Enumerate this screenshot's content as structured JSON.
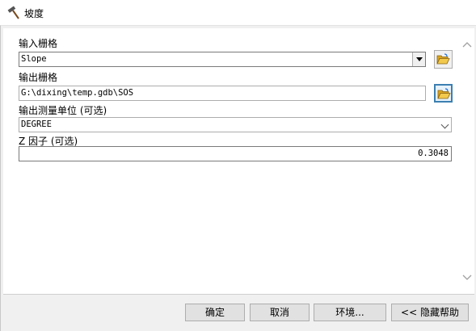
{
  "window": {
    "title": "坡度",
    "icon": "hammer-icon"
  },
  "params": {
    "input_raster": {
      "label": "输入栅格",
      "value": "Slope"
    },
    "output_raster": {
      "label": "输出栅格",
      "value": "G:\\dixing\\temp.gdb\\SOS"
    },
    "measurement": {
      "label": "输出测量单位 (可选)",
      "value": "DEGREE"
    },
    "zfactor": {
      "label": "Z 因子 (可选)",
      "value": "0.3048"
    }
  },
  "buttons": {
    "ok": "确定",
    "cancel": "取消",
    "env": "环境...",
    "help": "<< 隐藏帮助"
  },
  "icons": {
    "browse": "open-folder-icon",
    "scroll_up": "chevron-up-icon",
    "scroll_down": "chevron-down-icon"
  },
  "colors": {
    "active_border": "#3c7fb1",
    "folder": "#e8b730"
  }
}
